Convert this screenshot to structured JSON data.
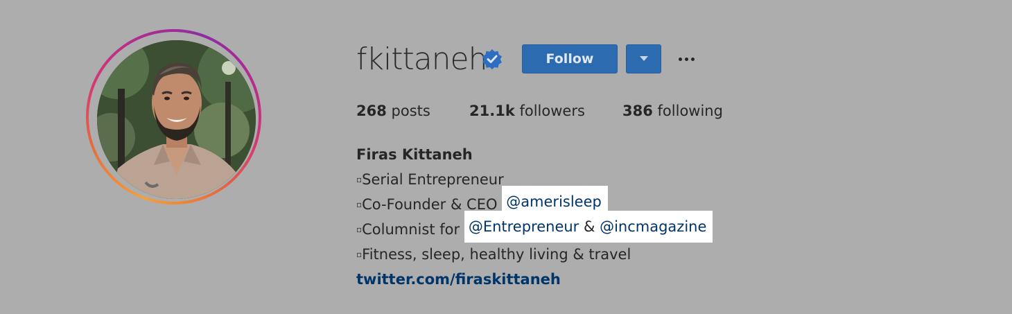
{
  "profile": {
    "username": "fkittaneh",
    "verified_icon": "verified-badge-icon",
    "follow_label": "Follow",
    "dropdown_icon": "caret-down-icon",
    "more_icon": "more-options-icon"
  },
  "stats": {
    "posts_count": "268",
    "posts_label": "posts",
    "followers_count": "21.1k",
    "followers_label": "followers",
    "following_count": "386",
    "following_label": "following"
  },
  "bio": {
    "full_name": "Firas Kittaneh",
    "bullet": "▫",
    "line1": "Serial Entrepreneur",
    "line2_prefix": "Co-Founder & CEO",
    "line2_mention": "@amerisleep",
    "line3_prefix": "Columnist for",
    "line3_mention1": "@Entrepreneur",
    "line3_joiner": "&",
    "line3_mention2": "@incmagazine",
    "line4": "Fitness, sleep, healthy living & travel",
    "website": "twitter.com/firaskittaneh"
  },
  "colors": {
    "background": "#adadad",
    "button": "#2d6bb1",
    "mention": "#003569",
    "highlight": "#ffffff"
  }
}
